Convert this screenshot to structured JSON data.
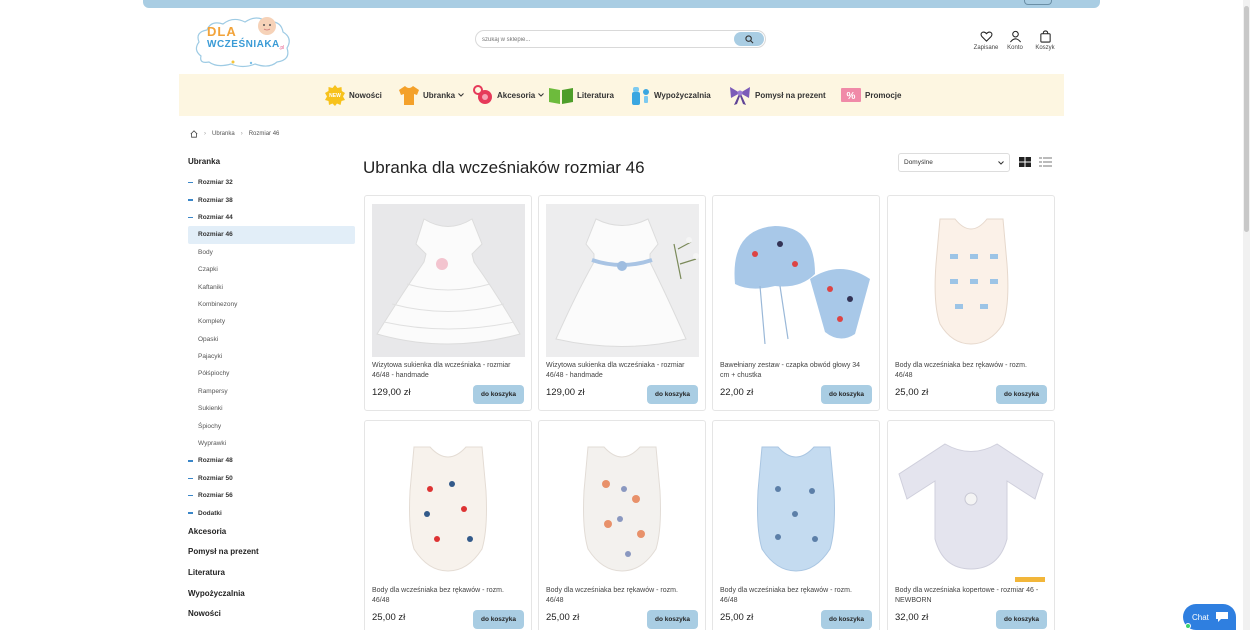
{
  "header": {
    "logo_text_top": "DLA",
    "logo_text_bottom": "WCZEŚNIAKA",
    "logo_tld": ".pl",
    "search_placeholder": "szukaj w sklepie...",
    "icons": [
      {
        "label": "Zapisane",
        "icon": "heart-icon"
      },
      {
        "label": "Konto",
        "icon": "user-icon"
      },
      {
        "label": "Koszyk",
        "icon": "bag-icon"
      }
    ]
  },
  "nav": {
    "items": [
      {
        "label": "Nowości",
        "icon": "new-badge-icon",
        "caret": false
      },
      {
        "label": "Ubranka",
        "icon": "shirt-icon",
        "caret": true
      },
      {
        "label": "Akcesoria",
        "icon": "pacifier-icon",
        "caret": true
      },
      {
        "label": "Literatura",
        "icon": "book-icon",
        "caret": false
      },
      {
        "label": "Wypożyczalnia",
        "icon": "bottle-icon",
        "caret": false
      },
      {
        "label": "Pomysł na prezent",
        "icon": "bow-icon",
        "caret": false
      },
      {
        "label": "Promocje",
        "icon": "percent-tag-icon",
        "caret": false
      }
    ]
  },
  "breadcrumb": [
    "Ubranka",
    "Rozmiar 46"
  ],
  "sidebar": {
    "heading": "Ubranka",
    "sizes_before": [
      "Rozmiar 32",
      "Rozmiar 38",
      "Rozmiar 44"
    ],
    "active": "Rozmiar 46",
    "subitems": [
      "Body",
      "Czapki",
      "Kaftaniki",
      "Kombinezony",
      "Komplety",
      "Opaski",
      "Pajacyki",
      "Półśpiochy",
      "Rampersy",
      "Sukienki",
      "Śpiochy",
      "Wyprawki"
    ],
    "sizes_after": [
      "Rozmiar 48",
      "Rozmiar 50",
      "Rozmiar 56",
      "Dodatki"
    ],
    "bottom": [
      "Akcesoria",
      "Pomysł na prezent",
      "Literatura",
      "Wypożyczalnia",
      "Nowości"
    ]
  },
  "main": {
    "title": "Ubranka dla wcześniaków rozmiar 46",
    "sort_value": "Domyślne",
    "cart_label": "do koszyka",
    "products": [
      {
        "name": "Wizytowa sukienka dla wcześniaka - rozmiar 46/48 - handmade",
        "price": "129,00 zł"
      },
      {
        "name": "Wizytowa sukienka dla wcześniaka - rozmiar 46/48 - handmade",
        "price": "129,00 zł"
      },
      {
        "name": "Bawełniany zestaw - czapka obwód głowy 34 cm + chustka",
        "price": "22,00 zł"
      },
      {
        "name": "Body dla wcześniaka bez rękawów - rozm. 46/48",
        "price": "25,00 zł"
      },
      {
        "name": "Body dla wcześniaka bez rękawów - rozm. 46/48",
        "price": "25,00 zł"
      },
      {
        "name": "Body dla wcześniaka bez rękawów - rozm. 46/48",
        "price": "25,00 zł"
      },
      {
        "name": "Body dla wcześniaka bez rękawów - rozm. 46/48",
        "price": "25,00 zł"
      },
      {
        "name": "Body dla wcześniaka kopertowe - rozmiar 46 - NEWBORN",
        "price": "32,00 zł"
      }
    ]
  },
  "chat": {
    "label": "Chat"
  },
  "colors": {
    "accent": "#a9cde3",
    "nav_bg": "#fdf6e1",
    "chat": "#2f7fe0",
    "active_bg": "#e2eef8"
  }
}
